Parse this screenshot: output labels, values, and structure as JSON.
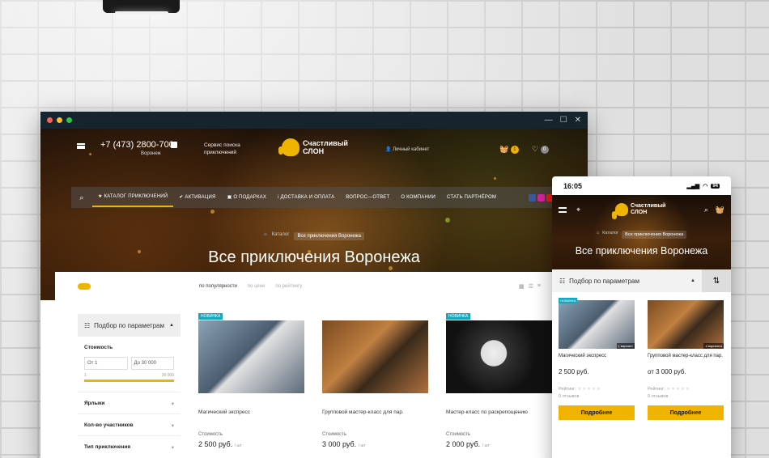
{
  "desktop": {
    "window_controls": [
      "—",
      "☐",
      "✕"
    ],
    "phone": "+7 (473) 2800-700",
    "city": "Воронеж",
    "service": "Сервис поиска приключений",
    "logo": {
      "line1": "Счастливый",
      "line2": "СЛОН"
    },
    "cabinet": "Личный кабинет",
    "cart_count": "1",
    "fav_count": "0",
    "nav": [
      "КАТАЛОГ ПРИКЛЮЧЕНИЙ",
      "АКТИВАЦИЯ",
      "О ПОДАРКАХ",
      "ДОСТАВКА И ОПЛАТА",
      "ВОПРОС—ОТВЕТ",
      "О КОМПАНИИ",
      "СТАТЬ ПАРТНЁРОМ"
    ],
    "breadcrumbs": {
      "home": "⌂",
      "catalog": "Каталог",
      "current": "Все приключения Воронежа"
    },
    "title": "Все приключения Воронежа",
    "sort": {
      "popular": "по популярности",
      "price": "по цене",
      "rating": "по рейтингу"
    },
    "filter": {
      "header": "Подбор по параметрам",
      "cost": "Стоимость",
      "from_placeholder": "От 1",
      "to_placeholder": "До 30 000",
      "min": "1",
      "max": "30 000",
      "labels": "Ярлыки",
      "participants": "Кол-во участников",
      "type": "Тип приключения"
    },
    "cards": [
      {
        "tag": "НОВИНКА",
        "name": "Магический экспресс",
        "price_label": "Стоимость",
        "price": "2 500 руб.",
        "unit": "/ шт"
      },
      {
        "tag": "",
        "name": "Групповой мастер-класс для пар.",
        "price_label": "Стоимость",
        "price": "3 000 руб.",
        "unit": "/ шт"
      },
      {
        "tag": "НОВИНКА",
        "name": "Мастер-класс по раскрепощению",
        "price_label": "Стоимость",
        "price": "2 000 руб.",
        "unit": "/ шт"
      }
    ]
  },
  "mobile": {
    "time": "16:05",
    "battery": "94",
    "logo": {
      "line1": "Счастливый",
      "line2": "СЛОН"
    },
    "breadcrumbs": {
      "home": "⌂",
      "catalog": "Каталог",
      "current": "Все приключения Воронежа"
    },
    "title": "Все приключения Воронежа",
    "filter": "Подбор по параметрам",
    "cards": [
      {
        "tag": "НОВИНКА",
        "caption": "1 вариант",
        "name": "Магический экспресс",
        "price": "2 500 руб.",
        "rating_label": "Рейтинг:",
        "reviews": "0 отзывов",
        "button": "Подробнее"
      },
      {
        "tag": "",
        "caption": "4 варианта",
        "name": "Групповой мастер-класс для пар.",
        "price": "от 3 000 руб.",
        "rating_label": "Рейтинг:",
        "reviews": "0 отзывов",
        "button": "Подробнее"
      }
    ]
  },
  "colors": {
    "accent": "#f0b400",
    "tag": "#14a8c0"
  }
}
